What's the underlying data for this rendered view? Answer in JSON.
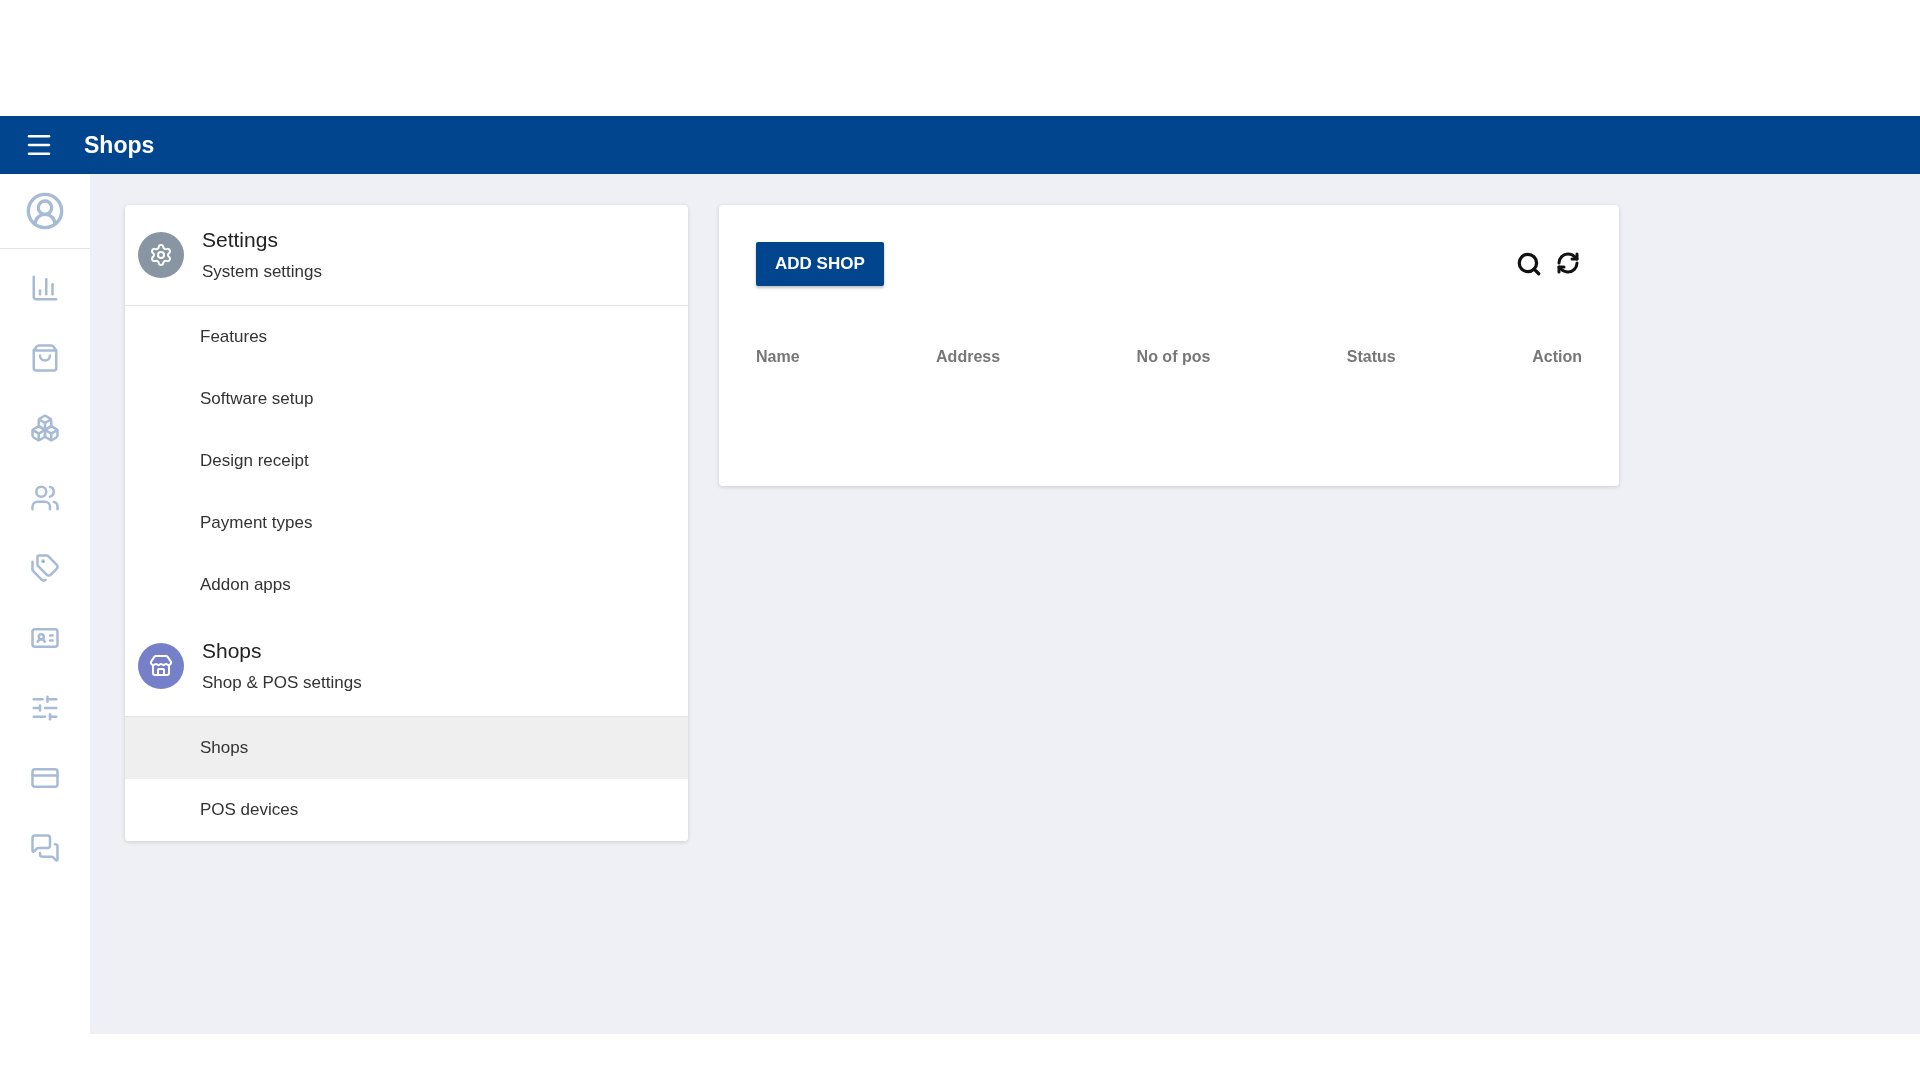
{
  "header": {
    "title": "Shops"
  },
  "menu_groups": [
    {
      "kind": "settings",
      "title": "Settings",
      "subtitle": "System settings",
      "items": [
        {
          "label": "Features",
          "selected": false
        },
        {
          "label": "Software setup",
          "selected": false
        },
        {
          "label": "Design receipt",
          "selected": false
        },
        {
          "label": "Payment types",
          "selected": false
        },
        {
          "label": "Addon apps",
          "selected": false
        }
      ]
    },
    {
      "kind": "shop",
      "title": "Shops",
      "subtitle": "Shop & POS settings",
      "items": [
        {
          "label": "Shops",
          "selected": true
        },
        {
          "label": "POS devices",
          "selected": false
        }
      ]
    }
  ],
  "shops_panel": {
    "add_button": "ADD SHOP",
    "columns": [
      "Name",
      "Address",
      "No of pos",
      "Status",
      "Action"
    ]
  }
}
